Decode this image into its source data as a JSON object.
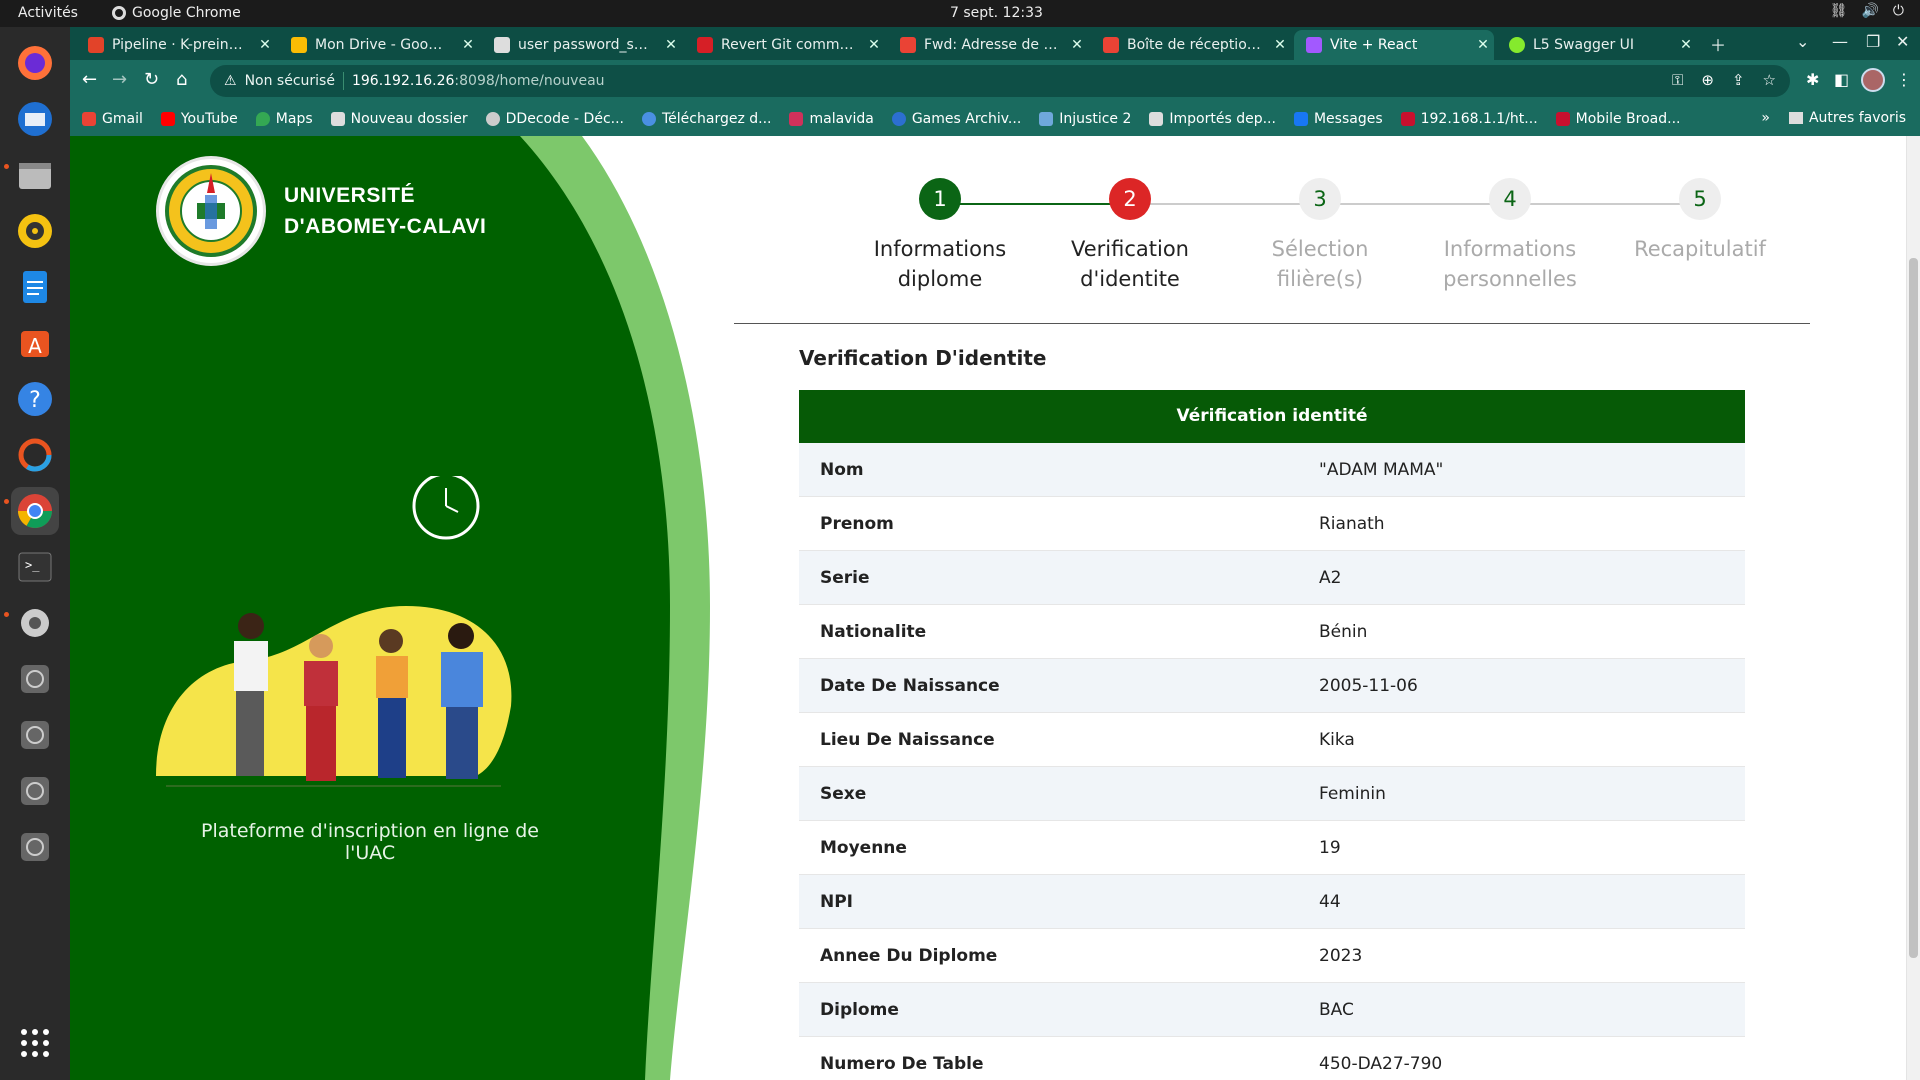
{
  "os": {
    "activities": "Activités",
    "app_name": "Google Chrome",
    "clock": "7 sept.  12:33"
  },
  "browser": {
    "tabs": [
      {
        "title": "Pipeline · K-preinscri",
        "color": "#e24329"
      },
      {
        "title": "Mon Drive - Google Dri",
        "color": "#fbbc04"
      },
      {
        "title": "user password_sdep",
        "color": "#dddddd"
      },
      {
        "title": "Revert Git commit : F",
        "color": "#d61f26"
      },
      {
        "title": "Fwd: Adresse de conf",
        "color": "#ea4335"
      },
      {
        "title": "Boîte de réception (",
        "color": "#ea4335"
      },
      {
        "title": "Vite + React",
        "color": "#a259ff",
        "active": true
      },
      {
        "title": "L5 Swagger UI",
        "color": "#85ea2d"
      }
    ],
    "address": {
      "security_label": "Non sécurisé",
      "host": "196.192.16.26",
      "path": ":8098/home/nouveau"
    },
    "bookmarks": [
      {
        "label": "Gmail",
        "color": "#ea4335"
      },
      {
        "label": "YouTube",
        "color": "#ff0000"
      },
      {
        "label": "Maps",
        "color": "#34a853"
      },
      {
        "label": "Nouveau dossier",
        "color": "#dddddd"
      },
      {
        "label": "DDecode - Déc...",
        "color": "#cccccc"
      },
      {
        "label": "Téléchargez d...",
        "color": "#4a90e2"
      },
      {
        "label": "malavida",
        "color": "#d0315b"
      },
      {
        "label": "Games Archiv...",
        "color": "#2c6fd1"
      },
      {
        "label": "Injustice 2",
        "color": "#6fa8dc"
      },
      {
        "label": "Importés dep...",
        "color": "#dddddd"
      },
      {
        "label": "Messages",
        "color": "#1877f2"
      },
      {
        "label": "192.168.1.1/ht...",
        "color": "#c8102e"
      },
      {
        "label": "Mobile Broad...",
        "color": "#c8102e"
      }
    ],
    "bookmarks_more": "»",
    "other_bookmarks": "Autres favoris"
  },
  "page": {
    "university": {
      "line1": "UNIVERSITÉ",
      "line2": "D'ABOMEY-CALAVI"
    },
    "tagline": "Plateforme d'inscription en ligne de l'UAC",
    "steps": [
      {
        "num": "1",
        "line1": "Informations",
        "line2": "diplome",
        "state": "done"
      },
      {
        "num": "2",
        "line1": "Verification",
        "line2": "d'identite",
        "state": "current"
      },
      {
        "num": "3",
        "line1": "Sélection",
        "line2": "filière(s)",
        "state": "pending"
      },
      {
        "num": "4",
        "line1": "Informations",
        "line2": "personnelles",
        "state": "pending"
      },
      {
        "num": "5",
        "line1": "Recapitulatif",
        "line2": "",
        "state": "pending"
      }
    ],
    "section_title": "Verification D'identite",
    "table": {
      "header": "Vérification identité",
      "rows": [
        {
          "key": "Nom",
          "value": "\"ADAM MAMA\""
        },
        {
          "key": "Prenom",
          "value": "Rianath"
        },
        {
          "key": "Serie",
          "value": "A2"
        },
        {
          "key": "Nationalite",
          "value": "Bénin"
        },
        {
          "key": "Date De Naissance",
          "value": "2005-11-06"
        },
        {
          "key": "Lieu De Naissance",
          "value": "Kika"
        },
        {
          "key": "Sexe",
          "value": "Feminin"
        },
        {
          "key": "Moyenne",
          "value": "19"
        },
        {
          "key": "NPI",
          "value": "44"
        },
        {
          "key": "Annee Du Diplome",
          "value": "2023"
        },
        {
          "key": "Diplome",
          "value": "BAC"
        },
        {
          "key": "Numero De Table",
          "value": "450-DA27-790"
        }
      ]
    }
  }
}
